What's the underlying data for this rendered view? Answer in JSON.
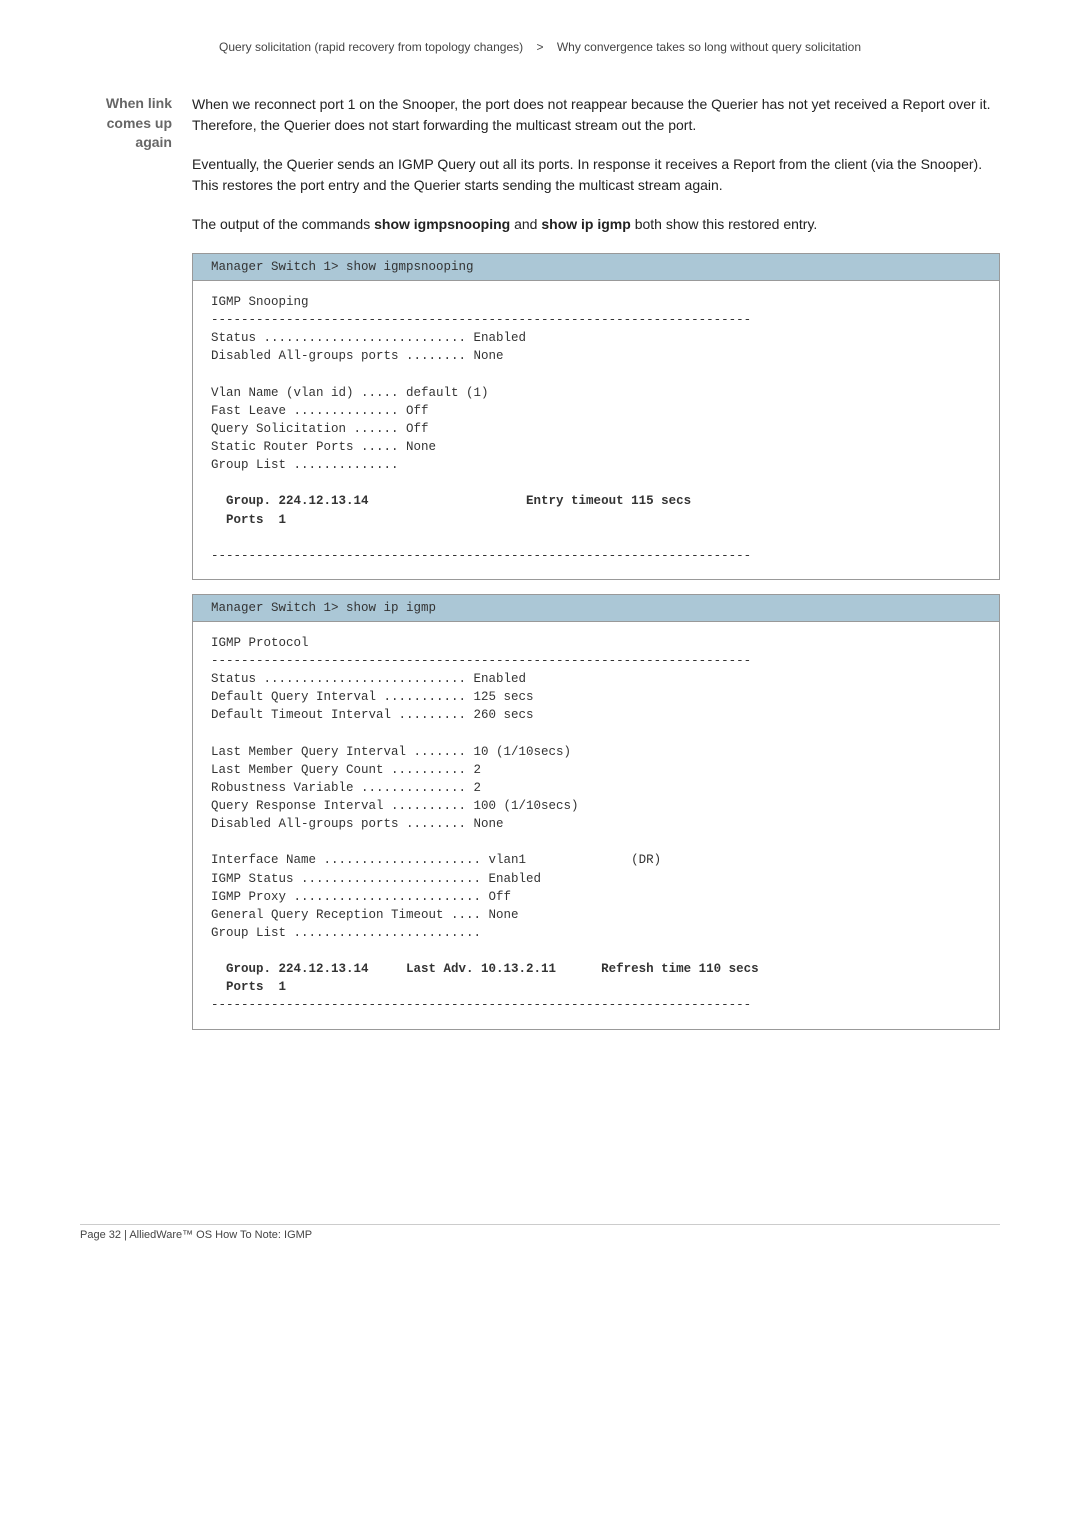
{
  "breadcrumb": {
    "left": "Query solicitation (rapid recovery from topology changes)",
    "sep": ">",
    "right": "Why convergence takes so long without query solicitation"
  },
  "sideLabel": {
    "l1": "When link",
    "l2": "comes up",
    "l3": "again"
  },
  "paragraphs": {
    "p1": "When we reconnect port 1 on the Snooper, the port does not reappear because the Querier has not yet received a Report over it. Therefore, the Querier does not start forwarding the multicast stream out the port.",
    "p2": "Eventually, the Querier sends an IGMP Query out all its ports. In response it receives a Report from the client (via the Snooper). This restores the port entry and the Querier starts sending the multicast stream again.",
    "p3a": "The output of the commands ",
    "p3cmd1": "show igmpsnooping",
    "p3b": " and ",
    "p3cmd2": "show ip igmp",
    "p3c": " both show this restored entry."
  },
  "terminal1": {
    "header": "Manager Switch 1> show igmpsnooping",
    "l1": "IGMP Snooping",
    "l2": "------------------------------------------------------------------------",
    "l3": "Status ........................... Enabled",
    "l4": "Disabled All-groups ports ........ None",
    "l5": "",
    "l6": "Vlan Name (vlan id) ..... default (1)",
    "l7": "Fast Leave .............. Off",
    "l8": "Query Solicitation ...... Off",
    "l9": "Static Router Ports ..... None",
    "l10": "Group List ..............",
    "l11": "",
    "l12a": "  Group. 224.12.13.14                     Entry timeout 115 secs",
    "l12b": "  Ports  1",
    "l13": "",
    "l14": "------------------------------------------------------------------------"
  },
  "terminal2": {
    "header": "Manager Switch 1> show ip igmp",
    "l1": "IGMP Protocol",
    "l2": "------------------------------------------------------------------------",
    "l3": "Status ........................... Enabled",
    "l4": "Default Query Interval ........... 125 secs",
    "l5": "Default Timeout Interval ......... 260 secs",
    "l6": "",
    "l7": "Last Member Query Interval ....... 10 (1/10secs)",
    "l8": "Last Member Query Count .......... 2",
    "l9": "Robustness Variable .............. 2",
    "l10": "Query Response Interval .......... 100 (1/10secs)",
    "l11": "Disabled All-groups ports ........ None",
    "l12": "",
    "l13": "Interface Name ..................... vlan1              (DR)",
    "l14": "IGMP Status ........................ Enabled",
    "l15": "IGMP Proxy ......................... Off",
    "l16": "General Query Reception Timeout .... None",
    "l17": "Group List .........................",
    "l18": "",
    "l19a": "  Group. 224.12.13.14     Last Adv. 10.13.2.11      Refresh time 110 secs",
    "l19b": "  Ports  1",
    "l20": "------------------------------------------------------------------------"
  },
  "footer": "Page 32 | AlliedWare™ OS How To Note: IGMP"
}
